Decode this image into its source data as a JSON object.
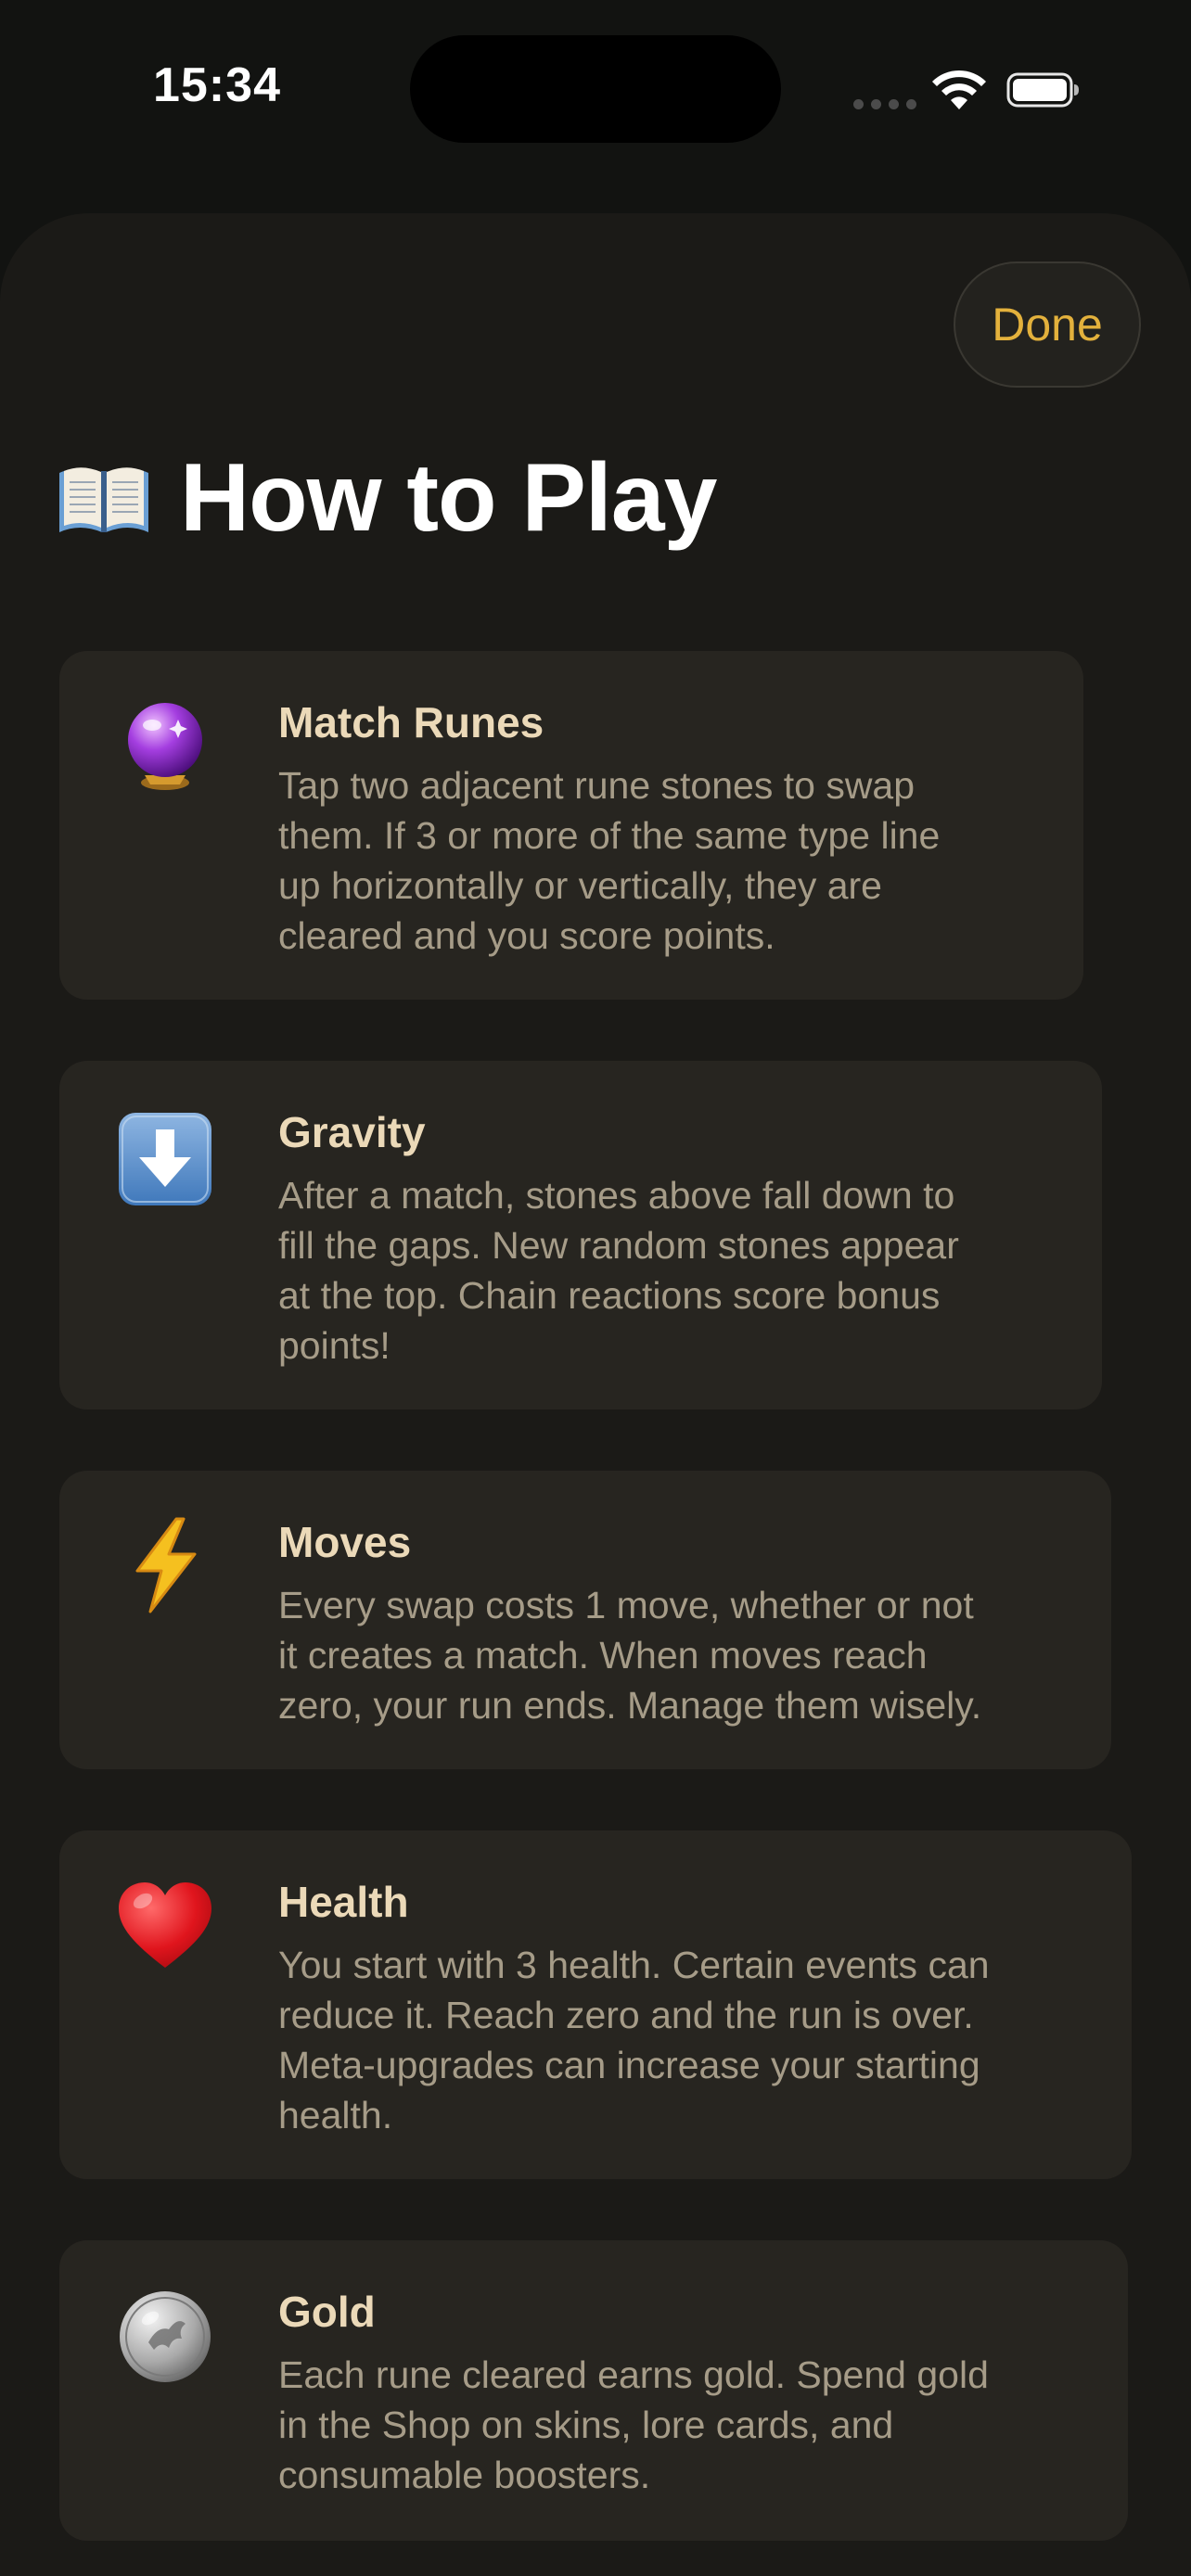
{
  "status_bar": {
    "time": "15:34"
  },
  "sheet": {
    "done_label": "Done",
    "title": "How to Play",
    "title_icon": "open-book-icon"
  },
  "cards": [
    {
      "icon": "crystal-ball-icon",
      "title": "Match Runes",
      "lines": [
        "Tap two adjacent rune stones to swap",
        "them. If 3 or more of the same type line",
        "up horizontally or vertically, they are",
        "cleared and you score points."
      ]
    },
    {
      "icon": "down-arrow-icon",
      "title": "Gravity",
      "lines": [
        "After a match, stones above fall down to",
        "fill the gaps. New random stones appear",
        "at the top. Chain reactions score bonus",
        "points!"
      ]
    },
    {
      "icon": "lightning-icon",
      "title": "Moves",
      "lines": [
        "Every swap costs 1 move, whether or not",
        "it creates a match. When moves reach",
        "zero, your run ends. Manage them wisely."
      ]
    },
    {
      "icon": "heart-icon",
      "title": "Health",
      "lines": [
        "You start with 3 health. Certain events can",
        "reduce it. Reach zero and the run is over.",
        "Meta-upgrades can increase your starting",
        "health."
      ]
    },
    {
      "icon": "coin-icon",
      "title": "Gold",
      "lines": [
        "Each rune cleared earns gold. Spend gold",
        "in the Shop on skins, lore cards, and",
        "consumable boosters."
      ]
    }
  ],
  "colors": {
    "accent": "#E3B13C",
    "card_background": "#272520",
    "sheet_background": "#1B1A17",
    "title_text": "#FFFFFF",
    "card_title_text": "#EBD9B8",
    "card_body_text": "#A69C88"
  }
}
